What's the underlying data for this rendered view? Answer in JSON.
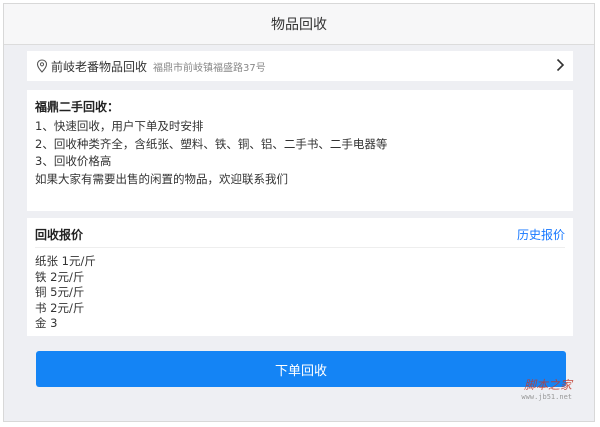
{
  "window": {
    "title": "物品回收"
  },
  "location": {
    "name": "前岐老番物品回收",
    "address": "福鼎市前岐镇福盛路37号",
    "pin_icon": "location-pin-icon",
    "chevron_icon": "chevron-right-icon"
  },
  "info": {
    "heading": "福鼎二手回收：",
    "lines": [
      "1、快速回收，用户下单及时安排",
      "2、回收种类齐全，含纸张、塑料、铁、铜、铝、二手书、二手电器等",
      "3、回收价格高",
      "如果大家有需要出售的闲置的物品，欢迎联系我们"
    ]
  },
  "prices": {
    "title": "回收报价",
    "history_link": "历史报价",
    "items": [
      "纸张 1元/斤",
      "铁 2元/斤",
      "铜 5元/斤",
      "书 2元/斤",
      "金 3"
    ]
  },
  "action": {
    "submit_label": "下单回收"
  },
  "watermark": {
    "text": "脚本之家",
    "url_text": "www.jb51.net"
  },
  "colors": {
    "accent": "#1484f5",
    "link": "#1677ff"
  }
}
